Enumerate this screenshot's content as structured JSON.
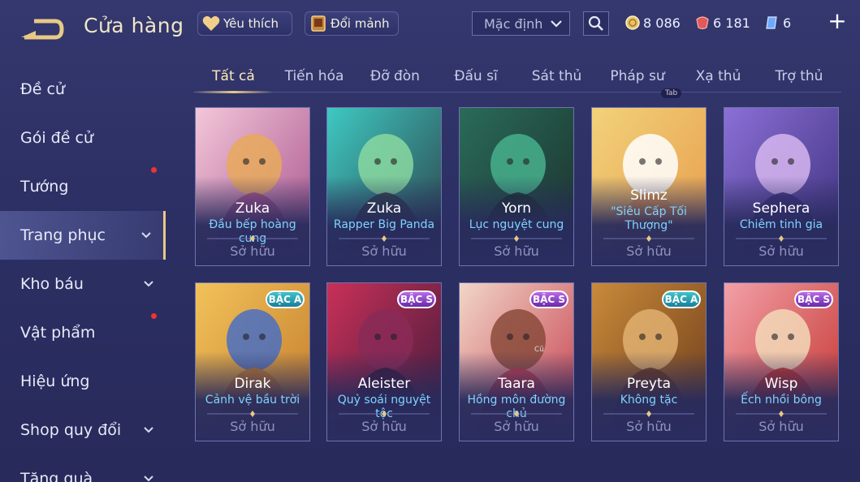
{
  "header": {
    "title": "Cửa hàng",
    "favorites_label": "Yêu thích",
    "shards_label": "Đổi mảnh",
    "sort_value": "Mặc định",
    "currencies": [
      {
        "name": "gold",
        "amount": "8 086",
        "icon": "gold-coin-icon",
        "color": "#e8c36a"
      },
      {
        "name": "red-voucher",
        "amount": "6 181",
        "icon": "red-voucher-icon",
        "color": "#e05a5a"
      },
      {
        "name": "blue-gem",
        "amount": "6",
        "icon": "blue-gem-icon",
        "color": "#6fa8ff"
      }
    ],
    "add_label": "+"
  },
  "sidebar": {
    "items": [
      {
        "label": "Đề cử",
        "chevron": false,
        "dot": false
      },
      {
        "label": "Gói đề cử",
        "chevron": false,
        "dot": true
      },
      {
        "label": "Tướng",
        "chevron": false,
        "dot": false
      },
      {
        "label": "Trang phục",
        "chevron": true,
        "dot": false,
        "active": true
      },
      {
        "label": "Kho báu",
        "chevron": true,
        "dot": true
      },
      {
        "label": "Vật phẩm",
        "chevron": false,
        "dot": false
      },
      {
        "label": "Hiệu ứng",
        "chevron": false,
        "dot": false
      },
      {
        "label": "Shop quy đổi",
        "chevron": true,
        "dot": false
      },
      {
        "label": "Tặng quà",
        "chevron": true,
        "dot": false
      }
    ]
  },
  "tabs": [
    {
      "label": "Tất cả",
      "active": true
    },
    {
      "label": "Tiến hóa"
    },
    {
      "label": "Đỡ đòn"
    },
    {
      "label": "Đấu sĩ"
    },
    {
      "label": "Sát thủ"
    },
    {
      "label": "Pháp sư"
    },
    {
      "label": "Xạ thủ"
    },
    {
      "label": "Trợ thủ"
    }
  ],
  "tab_hint": "Tab",
  "skins": [
    {
      "hero": "Zuka",
      "skin": "Đầu bếp hoàng cung",
      "status": "Sở hữu",
      "tier": "",
      "palette": [
        "#f3c7d9",
        "#a64f8a",
        "#e8a95c"
      ]
    },
    {
      "hero": "Zuka",
      "skin": "Rapper Big Panda",
      "status": "Sở hữu",
      "tier": "",
      "palette": [
        "#3ec9c2",
        "#2c3c44",
        "#8ad8a0"
      ]
    },
    {
      "hero": "Yorn",
      "skin": "Lục nguyệt cung",
      "status": "Sở hữu",
      "tier": "",
      "palette": [
        "#2a6b58",
        "#1b2f2c",
        "#47b08c"
      ]
    },
    {
      "hero": "Slimz",
      "skin": "\"Siêu Cấp Tối Thượng\"",
      "status": "Sở hữu",
      "tier": "",
      "palette": [
        "#f2d27a",
        "#e79a4a",
        "#ffffff"
      ]
    },
    {
      "hero": "Sephera",
      "skin": "Chiêm tinh gia",
      "status": "Sở hữu",
      "tier": "",
      "palette": [
        "#8b6fd6",
        "#3b2f7a",
        "#d6b6f0"
      ]
    },
    {
      "hero": "Dirak",
      "skin": "Cảnh vệ bầu trời",
      "status": "Sở hữu",
      "tier": "BẬC A",
      "tier_class": "a",
      "palette": [
        "#f2c35a",
        "#c2792a",
        "#4a6fc2"
      ]
    },
    {
      "hero": "Aleister",
      "skin": "Quỷ soái nguyệt tộc",
      "status": "Sở hữu",
      "tier": "BẬC S",
      "tier_class": "s",
      "palette": [
        "#c93058",
        "#3a1a3a",
        "#8a2a58"
      ]
    },
    {
      "hero": "Taara",
      "skin": "Hồng môn đường chủ",
      "status": "Sở hữu",
      "tier": "BẬC S",
      "tier_class": "s",
      "palette": [
        "#f1d6c8",
        "#c53a4a",
        "#8a4a3a"
      ],
      "extra_label": "Cũ"
    },
    {
      "hero": "Preyta",
      "skin": "Không tặc",
      "status": "Sở hữu",
      "tier": "BẬC A",
      "tier_class": "a",
      "palette": [
        "#c98a3a",
        "#6a3a1a",
        "#e0b070"
      ]
    },
    {
      "hero": "Wisp",
      "skin": "Ếch nhồi bông",
      "status": "Sở hữu",
      "tier": "BẬC S",
      "tier_class": "s",
      "palette": [
        "#f2a0a8",
        "#c2302a",
        "#f3d9b8"
      ]
    }
  ]
}
